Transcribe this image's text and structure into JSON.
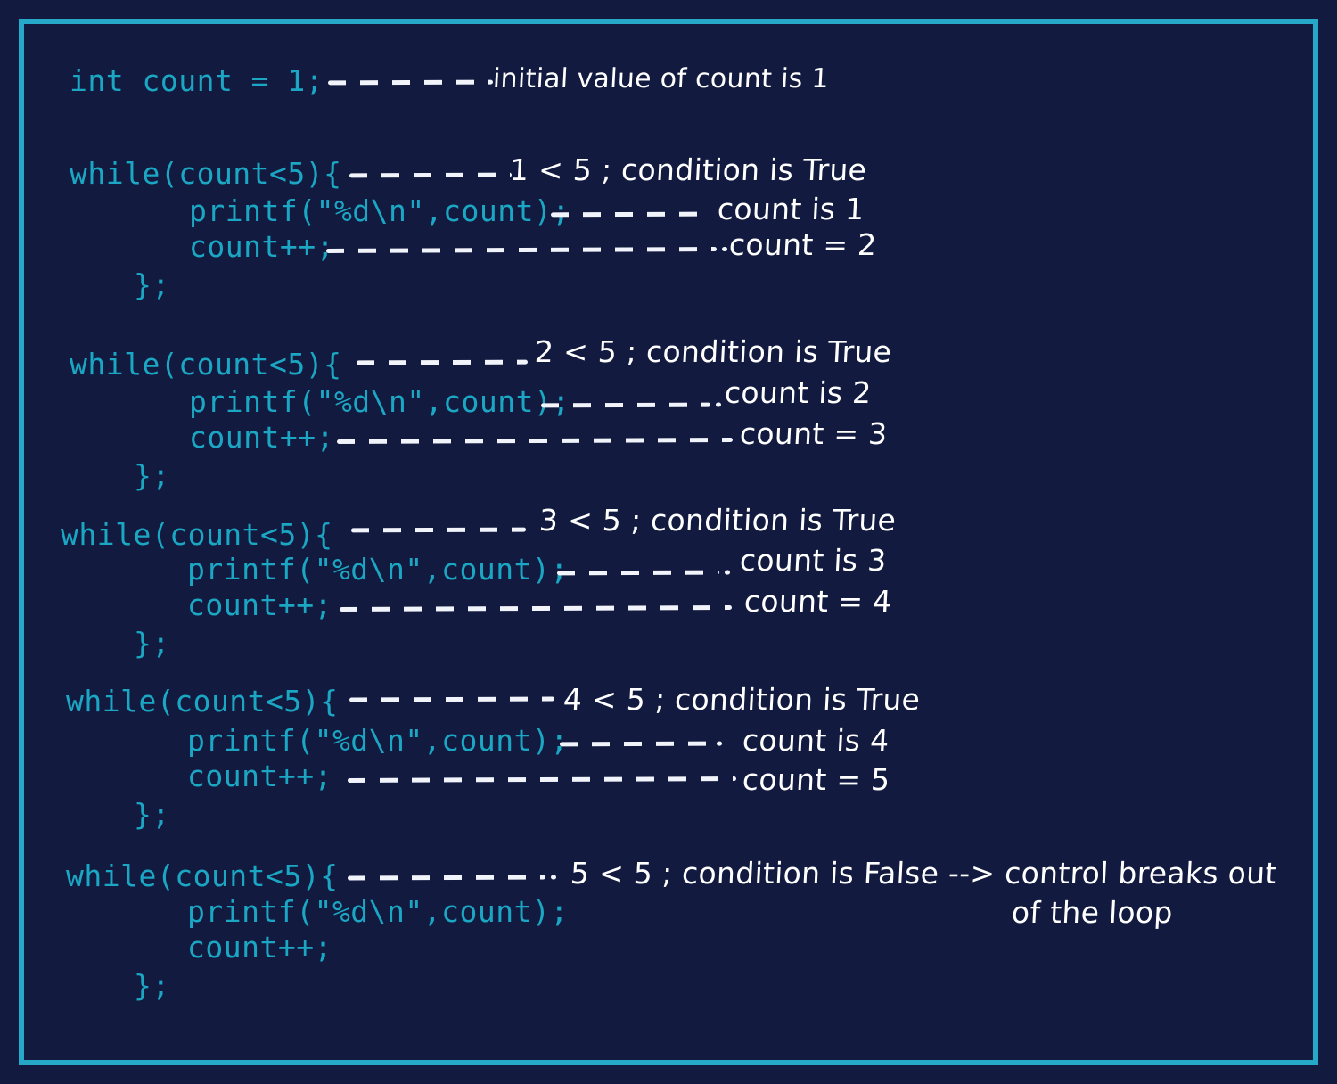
{
  "slide": {
    "background_color": "#121a3f",
    "border_color": "#26a8c8",
    "code_color": "#1ba7c3",
    "annotation_color": "#ffffff"
  },
  "code": {
    "init": "int count = 1;",
    "while_header": "while(count<5){",
    "printf": "printf(\"%d\\n\",count);",
    "increment": "count++;",
    "close": "};"
  },
  "blocks": [
    {
      "id": "init",
      "code_lines": [
        {
          "text": "int count = 1;"
        }
      ],
      "annotations": [
        {
          "text": "initial value of count is 1"
        }
      ]
    },
    {
      "id": "iteration-1",
      "code_lines": [
        {
          "text": "while(count<5){"
        },
        {
          "text": "printf(\"%d\\n\",count);"
        },
        {
          "text": "count++;"
        },
        {
          "text": "};"
        }
      ],
      "annotations": [
        {
          "text": "1 < 5 ; condition is True"
        },
        {
          "text": "count is 1"
        },
        {
          "text": "count = 2"
        }
      ]
    },
    {
      "id": "iteration-2",
      "code_lines": [
        {
          "text": "while(count<5){"
        },
        {
          "text": "printf(\"%d\\n\",count);"
        },
        {
          "text": "count++;"
        },
        {
          "text": "};"
        }
      ],
      "annotations": [
        {
          "text": "2 < 5 ; condition is True"
        },
        {
          "text": "count is 2"
        },
        {
          "text": "count = 3"
        }
      ]
    },
    {
      "id": "iteration-3",
      "code_lines": [
        {
          "text": "while(count<5){"
        },
        {
          "text": "printf(\"%d\\n\",count);"
        },
        {
          "text": "count++;"
        },
        {
          "text": "};"
        }
      ],
      "annotations": [
        {
          "text": "3 < 5 ; condition is True"
        },
        {
          "text": "count is 3"
        },
        {
          "text": "count = 4"
        }
      ]
    },
    {
      "id": "iteration-4",
      "code_lines": [
        {
          "text": "while(count<5){"
        },
        {
          "text": "printf(\"%d\\n\",count);"
        },
        {
          "text": "count++;"
        },
        {
          "text": "};"
        }
      ],
      "annotations": [
        {
          "text": "4 < 5 ; condition is True"
        },
        {
          "text": "count is 4"
        },
        {
          "text": "count = 5"
        }
      ]
    },
    {
      "id": "iteration-5",
      "code_lines": [
        {
          "text": "while(count<5){"
        },
        {
          "text": "printf(\"%d\\n\",count);"
        },
        {
          "text": "count++;"
        },
        {
          "text": "};"
        }
      ],
      "annotations": [
        {
          "text": "5 < 5 ; condition is False --> control breaks out"
        },
        {
          "text": "of the loop"
        }
      ]
    }
  ],
  "lines": {
    "b0_c1": "int count = 1;",
    "b1_c1": "while(count<5){",
    "b1_c2": "printf(\"%d\\n\",count);",
    "b1_c3": "count++;",
    "b1_c4": "};",
    "b2_c1": "while(count<5){",
    "b2_c2": "printf(\"%d\\n\",count);",
    "b2_c3": "count++;",
    "b2_c4": "};",
    "b3_c1": "while(count<5){",
    "b3_c2": "printf(\"%d\\n\",count);",
    "b3_c3": "count++;",
    "b3_c4": "};",
    "b4_c1": "while(count<5){",
    "b4_c2": "printf(\"%d\\n\",count);",
    "b4_c3": "count++;",
    "b4_c4": "};",
    "b5_c1": "while(count<5){",
    "b5_c2": "printf(\"%d\\n\",count);",
    "b5_c3": "count++;",
    "b5_c4": "};"
  },
  "notes": {
    "b0_a1": "initial value of count is 1",
    "b1_a1": "1 < 5 ; condition is True",
    "b1_a2": "count is 1",
    "b1_a3": "count = 2",
    "b2_a1": "2 < 5 ; condition is True",
    "b2_a2": "count is 2",
    "b2_a3": "count = 3",
    "b3_a1": "3 < 5 ; condition is True",
    "b3_a2": "count is 3",
    "b3_a3": "count = 4",
    "b4_a1": "4 < 5 ; condition is True",
    "b4_a2": "count is 4",
    "b4_a3": "count = 5",
    "b5_a1": "5 < 5 ; condition is False --> control breaks out",
    "b5_a2": "of the loop"
  }
}
